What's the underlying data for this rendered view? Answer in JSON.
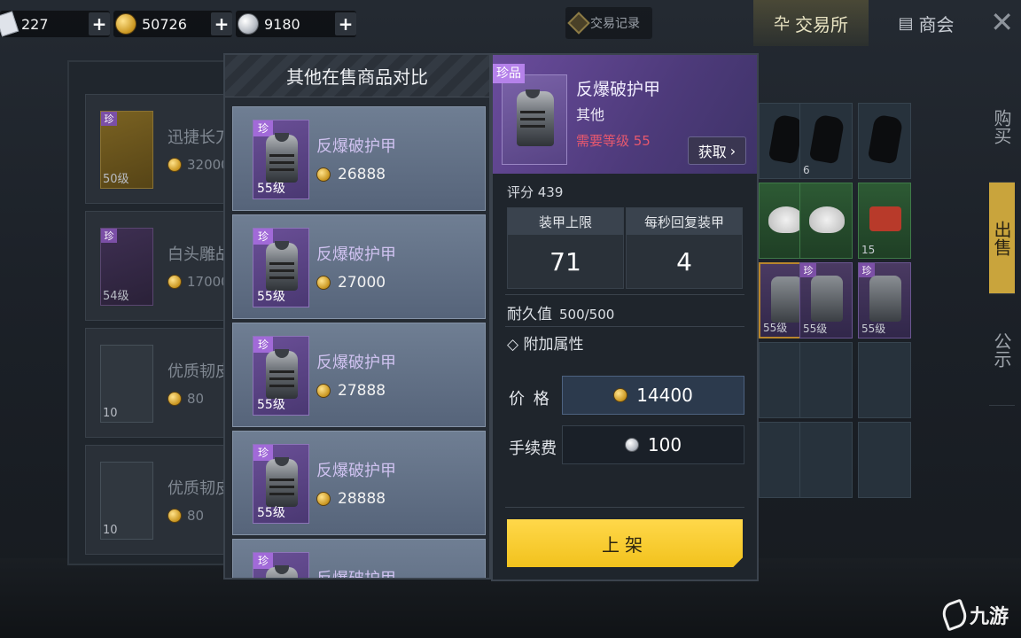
{
  "currencies": [
    {
      "icon": "ticket-icon",
      "value": "227"
    },
    {
      "icon": "gold-coin-icon",
      "value": "50726"
    },
    {
      "icon": "silver-coin-icon",
      "value": "9180"
    }
  ],
  "top_nav": {
    "trade_record": "交易记录",
    "exchange": "交易所",
    "chamber": "商会"
  },
  "bg_list": [
    {
      "name": "迅捷长刀",
      "price": "32000",
      "level": "50级",
      "rarity": "珍"
    },
    {
      "name": "白头雕战",
      "price": "17000",
      "level": "54级",
      "rarity": "珍"
    },
    {
      "name": "优质韧皮",
      "price": "80",
      "level": "10"
    },
    {
      "name": "优质韧皮",
      "price": "80",
      "level": "10"
    }
  ],
  "bg_grid": {
    "counts": [
      "6",
      "15"
    ],
    "levels": [
      "55级",
      "55级",
      "55级"
    ]
  },
  "side_tabs": [
    "购买",
    "出售",
    "公示"
  ],
  "comparison": {
    "title": "其他在售商品对比",
    "items": [
      {
        "rarity": "珍",
        "name": "反爆破护甲",
        "level": "55级",
        "price": "26888"
      },
      {
        "rarity": "珍",
        "name": "反爆破护甲",
        "level": "55级",
        "price": "27000"
      },
      {
        "rarity": "珍",
        "name": "反爆破护甲",
        "level": "55级",
        "price": "27888"
      },
      {
        "rarity": "珍",
        "name": "反爆破护甲",
        "level": "55级",
        "price": "28888"
      },
      {
        "rarity": "珍",
        "name": "反爆破护甲",
        "level": "",
        "price": ""
      }
    ]
  },
  "detail": {
    "rarity": "珍品",
    "name": "反爆破护甲",
    "type": "其他",
    "requirement": "需要等级 55",
    "get_button": "获取",
    "score": "评分 439",
    "stats": [
      {
        "label": "装甲上限",
        "value": "71"
      },
      {
        "label": "每秒回复装甲",
        "value": "4"
      }
    ],
    "durability_label": "耐久值",
    "durability_value": "500/500",
    "extra_attr": "◇ 附加属性",
    "price_label": "价 格",
    "price_value": "14400",
    "fee_label": "手续费",
    "fee_value": "100",
    "list_button": "上架"
  },
  "watermark": "九游",
  "colors": {
    "rare_purple": "#6a4f97",
    "requirement_red": "#e6586e",
    "list_button_yellow": "#f2c21d"
  }
}
